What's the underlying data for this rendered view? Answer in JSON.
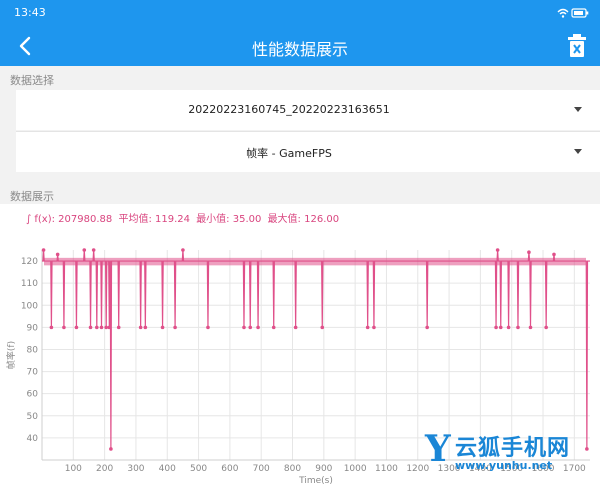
{
  "status_bar": {
    "time": "13:43"
  },
  "app_bar": {
    "title": "性能数据展示"
  },
  "data_select": {
    "section_label": "数据选择",
    "file_value": "20220223160745_20220223163651",
    "metric_value": "帧率 - GameFPS"
  },
  "data_display": {
    "section_label": "数据展示",
    "stats": {
      "integral": "∫ f(x): 207980.88",
      "average": "平均值: 119.24",
      "min": "最小值: 35.00",
      "max": "最大值: 126.00"
    }
  },
  "colors": {
    "accent": "#1e96ee",
    "series": "#e0508a"
  },
  "watermark": {
    "letter": "Y",
    "brand": "云狐手机网",
    "url": "www.yunhu.net"
  },
  "chart_data": {
    "type": "line",
    "xlabel": "Time(s)",
    "ylabel": "帧率(f)",
    "xlim": [
      0,
      1750
    ],
    "ylim": [
      30,
      125
    ],
    "x_ticks": [
      100,
      200,
      300,
      400,
      500,
      600,
      700,
      800,
      900,
      1000,
      1100,
      1200,
      1300,
      1400,
      1500,
      1600,
      1700
    ],
    "y_ticks": [
      40,
      50,
      60,
      70,
      80,
      90,
      100,
      110,
      120
    ],
    "grid": true,
    "legend": "none",
    "baseline": 120,
    "series": [
      {
        "values_note": "",
        "dips": [
          {
            "x": 30,
            "y": 90
          },
          {
            "x": 70,
            "y": 90
          },
          {
            "x": 110,
            "y": 90
          },
          {
            "x": 155,
            "y": 90
          },
          {
            "x": 175,
            "y": 90
          },
          {
            "x": 190,
            "y": 90
          },
          {
            "x": 205,
            "y": 90
          },
          {
            "x": 215,
            "y": 90
          },
          {
            "x": 220,
            "y": 35
          },
          {
            "x": 245,
            "y": 90
          },
          {
            "x": 315,
            "y": 90
          },
          {
            "x": 330,
            "y": 90
          },
          {
            "x": 385,
            "y": 90
          },
          {
            "x": 425,
            "y": 90
          },
          {
            "x": 530,
            "y": 90
          },
          {
            "x": 645,
            "y": 90
          },
          {
            "x": 665,
            "y": 90
          },
          {
            "x": 690,
            "y": 90
          },
          {
            "x": 740,
            "y": 90
          },
          {
            "x": 810,
            "y": 90
          },
          {
            "x": 895,
            "y": 90
          },
          {
            "x": 1040,
            "y": 90
          },
          {
            "x": 1060,
            "y": 90
          },
          {
            "x": 1230,
            "y": 90
          },
          {
            "x": 1450,
            "y": 90
          },
          {
            "x": 1465,
            "y": 90
          },
          {
            "x": 1490,
            "y": 90
          },
          {
            "x": 1520,
            "y": 90
          },
          {
            "x": 1560,
            "y": 90
          },
          {
            "x": 1610,
            "y": 90
          },
          {
            "x": 1740,
            "y": 35
          }
        ],
        "peaks": [
          {
            "x": 5,
            "y": 125
          },
          {
            "x": 50,
            "y": 123
          },
          {
            "x": 135,
            "y": 125
          },
          {
            "x": 165,
            "y": 125
          },
          {
            "x": 450,
            "y": 125
          },
          {
            "x": 1455,
            "y": 125
          },
          {
            "x": 1555,
            "y": 124
          },
          {
            "x": 1635,
            "y": 123
          }
        ]
      }
    ]
  }
}
